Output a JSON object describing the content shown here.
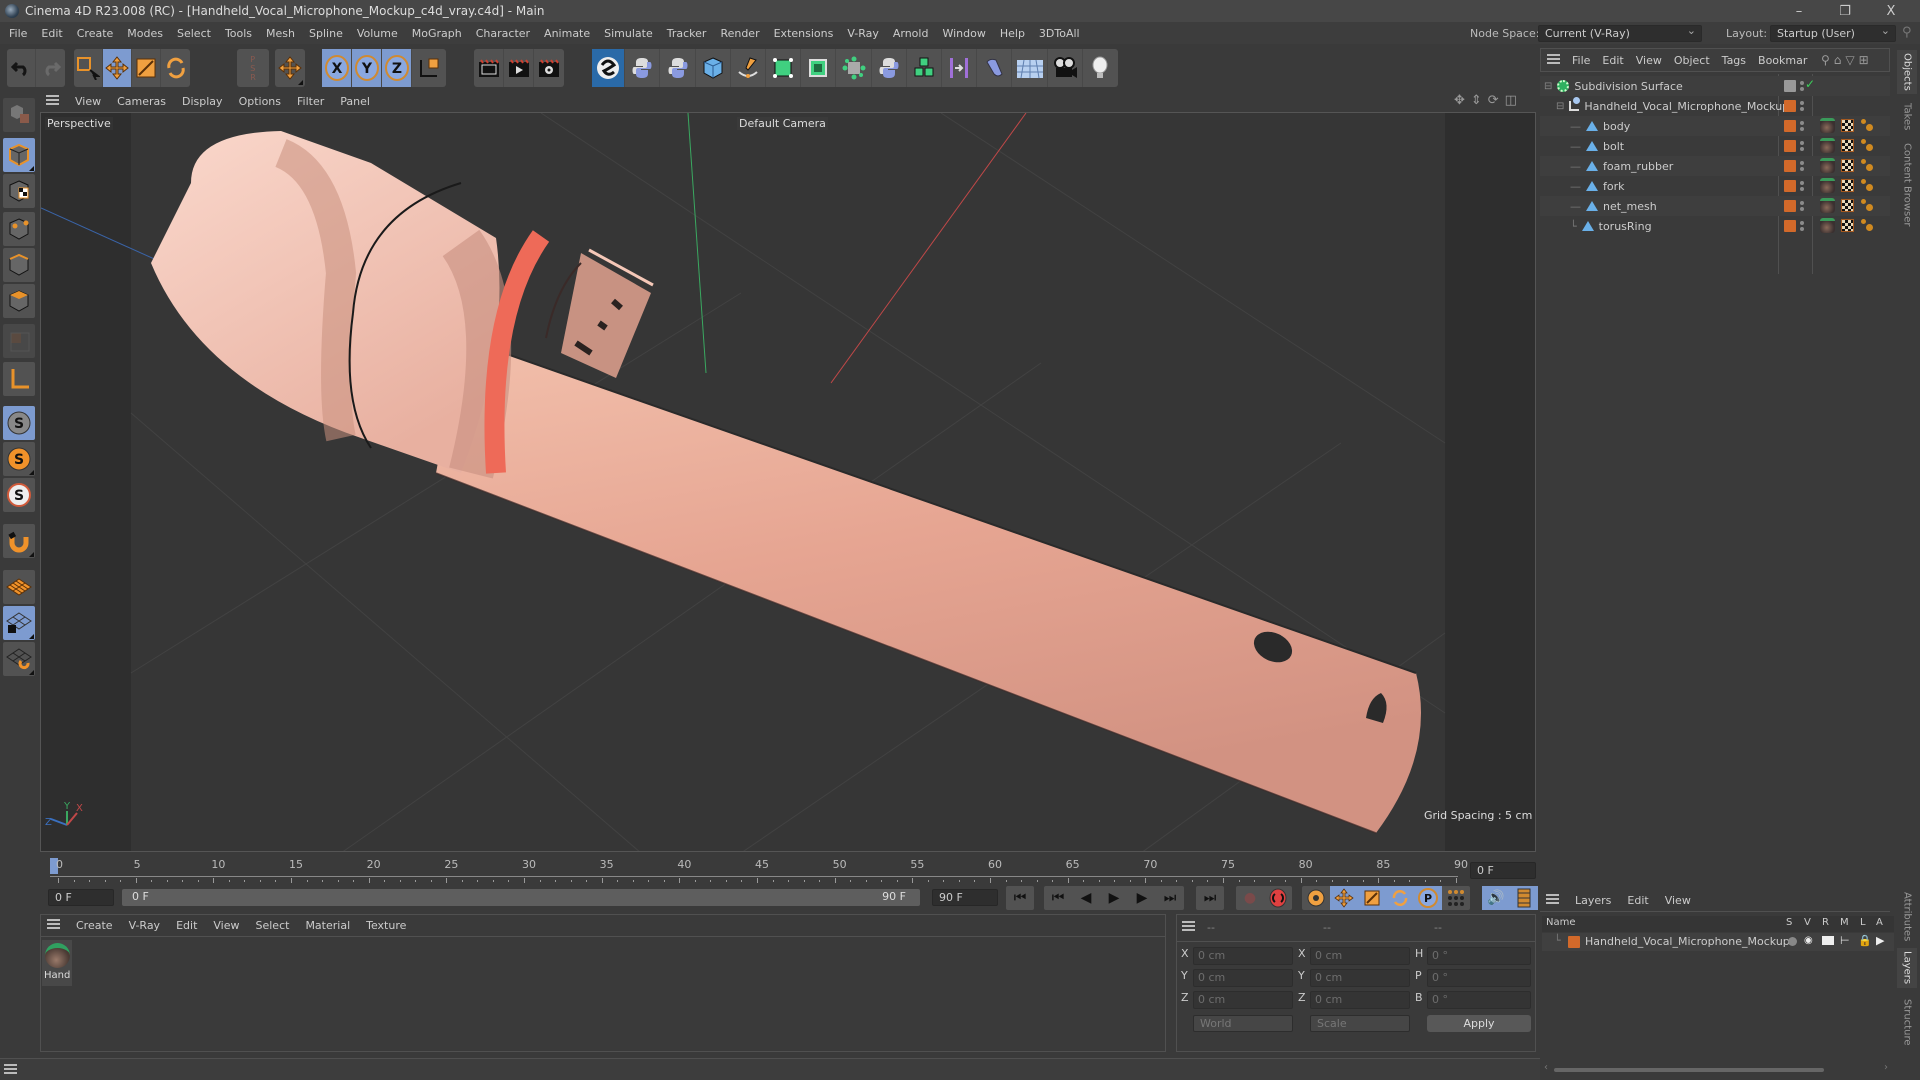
{
  "window": {
    "title": "Cinema 4D R23.008 (RC) - [Handheld_Vocal_Microphone_Mockup_c4d_vray.c4d] - Main",
    "controls": {
      "minimize": "–",
      "restore": "❐",
      "close": "X"
    }
  },
  "menubar": {
    "items": [
      "File",
      "Edit",
      "Create",
      "Modes",
      "Select",
      "Tools",
      "Mesh",
      "Spline",
      "Volume",
      "MoGraph",
      "Character",
      "Animate",
      "Simulate",
      "Tracker",
      "Render",
      "Extensions",
      "V-Ray",
      "Arnold",
      "Window",
      "Help",
      "3DToAll"
    ],
    "node_space_label": "Node Space:",
    "node_space_value": "Current (V-Ray)",
    "layout_label": "Layout:",
    "layout_value": "Startup (User)"
  },
  "toolbar": {
    "icons": [
      "undo-icon",
      "redo-icon",
      "live-selection-icon",
      "move-icon",
      "scale-icon",
      "rotate-icon",
      "psr-icon",
      "transform-icon",
      "x-axis-icon",
      "y-axis-icon",
      "z-axis-icon",
      "coordinate-system-icon",
      "render-view-icon",
      "render-picture-viewer-icon",
      "render-settings-icon",
      "vray-icon",
      "python-icon",
      "python-icon",
      "cube-icon",
      "pen-icon",
      "subdivision-icon",
      "extrude-icon",
      "polygon-object-icon",
      "python-icon",
      "array-icon",
      "symmetry-icon",
      "bend-icon",
      "floor-icon",
      "camera-icon",
      "light-icon"
    ],
    "axis_labels": [
      "X",
      "Y",
      "Z"
    ]
  },
  "left_toolbar": {
    "icons": [
      "make-editable-icon",
      "model-mode-icon",
      "texture-mode-icon",
      "point-mode-icon",
      "edge-mode-icon",
      "polygon-mode-icon",
      "uv-mode-icon",
      "axis-mode-icon",
      "solo-off-icon",
      "solo-single-icon",
      "solo-hierarchy-icon",
      "snap-magnet-icon",
      "workplane-icon",
      "locked-workplane-icon",
      "workplane-sync-icon"
    ]
  },
  "viewport": {
    "menu": [
      "View",
      "Cameras",
      "Display",
      "Options",
      "Filter",
      "Panel"
    ],
    "view_name": "Perspective",
    "camera_label": "Default Camera",
    "grid_spacing": "Grid Spacing : 5 cm",
    "axis": {
      "x": "X",
      "y": "Y",
      "z": "Z"
    },
    "colors": {
      "background": "#363636",
      "body": "#e9aa98",
      "ring": "#ee6a58",
      "x_axis": "#c04848",
      "y_axis": "#3aa860",
      "z_axis": "#3a70c0"
    }
  },
  "timeline": {
    "ticks": [
      "0",
      "5",
      "10",
      "15",
      "20",
      "25",
      "30",
      "35",
      "40",
      "45",
      "50",
      "55",
      "60",
      "65",
      "70",
      "75",
      "80",
      "85",
      "90"
    ],
    "current_frame_right": "0 F",
    "start_field": "0 F",
    "range_start": "0 F",
    "range_end": "90 F",
    "end_field": "90 F"
  },
  "transport": {
    "buttons": [
      "go-to-start-icon",
      "previous-key-icon",
      "previous-frame-icon",
      "play-icon",
      "next-frame-icon",
      "next-key-icon",
      "go-to-end-icon",
      "record-keys-icon",
      "autokey-icon",
      "keyframe-selection-icon",
      "position-key-icon",
      "scale-key-icon",
      "rotation-key-icon",
      "parameter-key-icon",
      "point-level-icon",
      "sound-icon",
      "timeline-icon"
    ]
  },
  "material_manager": {
    "menu": [
      "Create",
      "V-Ray",
      "Edit",
      "View",
      "Select",
      "Material",
      "Texture"
    ],
    "materials": [
      {
        "name": "Hand"
      }
    ]
  },
  "coordinates": {
    "headers": [
      "--",
      "--",
      "--"
    ],
    "rows": [
      {
        "l1": "X",
        "v1": "0 cm",
        "l2": "X",
        "v2": "0 cm",
        "l3": "H",
        "v3": "0 °"
      },
      {
        "l1": "Y",
        "v1": "0 cm",
        "l2": "Y",
        "v2": "0 cm",
        "l3": "P",
        "v3": "0 °"
      },
      {
        "l1": "Z",
        "v1": "0 cm",
        "l2": "Z",
        "v2": "0 cm",
        "l3": "B",
        "v3": "0 °"
      }
    ],
    "mode_select": "World",
    "type_select": "Scale",
    "apply_label": "Apply"
  },
  "object_manager": {
    "menu": [
      "File",
      "Edit",
      "View",
      "Object",
      "Tags",
      "Bookmar"
    ],
    "objects": [
      {
        "name": "Subdivision Surface",
        "level": 0,
        "type": "subdivision"
      },
      {
        "name": "Handheld_Vocal_Microphone_Mockup",
        "level": 1,
        "type": "null"
      },
      {
        "name": "body",
        "level": 2,
        "type": "polygon"
      },
      {
        "name": "bolt",
        "level": 2,
        "type": "polygon"
      },
      {
        "name": "foam_rubber",
        "level": 2,
        "type": "polygon"
      },
      {
        "name": "fork",
        "level": 2,
        "type": "polygon"
      },
      {
        "name": "net_mesh",
        "level": 2,
        "type": "polygon"
      },
      {
        "name": "torusRing",
        "level": 2,
        "type": "polygon"
      }
    ]
  },
  "side_tabs_top": [
    "Objects",
    "Takes",
    "Content Browser"
  ],
  "side_tabs_bottom": [
    "Attributes",
    "Layers",
    "Structure"
  ],
  "layer_manager": {
    "menu": [
      "Layers",
      "Edit",
      "View"
    ],
    "columns": [
      "Name",
      "S",
      "V",
      "R",
      "M",
      "L",
      "A"
    ],
    "layers": [
      {
        "name": "Handheld_Vocal_Microphone_Mockup",
        "color": "#d2692a"
      }
    ]
  }
}
